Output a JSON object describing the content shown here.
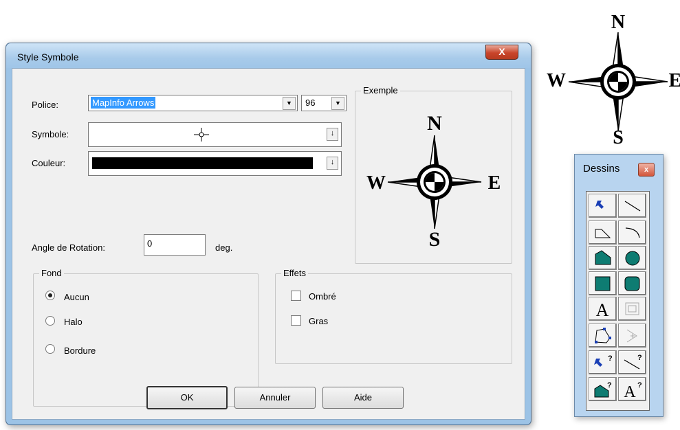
{
  "dialog": {
    "title": "Style Symbole",
    "close_label": "X",
    "police": {
      "label": "Police:",
      "value": "MapInfo Arrows",
      "size": "96"
    },
    "symbole": {
      "label": "Symbole:",
      "glyph": "compass-glyph"
    },
    "couleur": {
      "label": "Couleur:",
      "value": "#000000"
    },
    "exemple": {
      "label": "Exemple",
      "n": "N",
      "s": "S",
      "e": "E",
      "w": "W"
    },
    "angle": {
      "label": "Angle de Rotation:",
      "value": "0",
      "unit": "deg."
    },
    "fond": {
      "label": "Fond",
      "options": [
        {
          "label": "Aucun",
          "selected": true
        },
        {
          "label": "Halo",
          "selected": false
        },
        {
          "label": "Bordure",
          "selected": false
        }
      ]
    },
    "effets": {
      "label": "Effets",
      "options": [
        {
          "label": "Ombré",
          "checked": false
        },
        {
          "label": "Gras",
          "checked": false
        }
      ]
    },
    "buttons": {
      "ok": "OK",
      "cancel": "Annuler",
      "help": "Aide"
    }
  },
  "compass": {
    "n": "N",
    "s": "S",
    "e": "E",
    "w": "W"
  },
  "palette": {
    "title": "Dessins",
    "close_label": "x",
    "tools": [
      "symbol-tool-icon",
      "line-tool-icon",
      "polyline-tool-icon",
      "arc-tool-icon",
      "polygon-tool-icon",
      "ellipse-tool-icon",
      "rectangle-tool-icon",
      "rounded-rectangle-tool-icon",
      "text-tool-icon",
      "frame-tool-icon",
      "reshape-tool-icon",
      "add-node-tool-icon",
      "symbol-style-icon",
      "line-style-icon",
      "region-style-icon",
      "text-style-icon"
    ],
    "text_tool_label": "A",
    "style_question": "?"
  }
}
